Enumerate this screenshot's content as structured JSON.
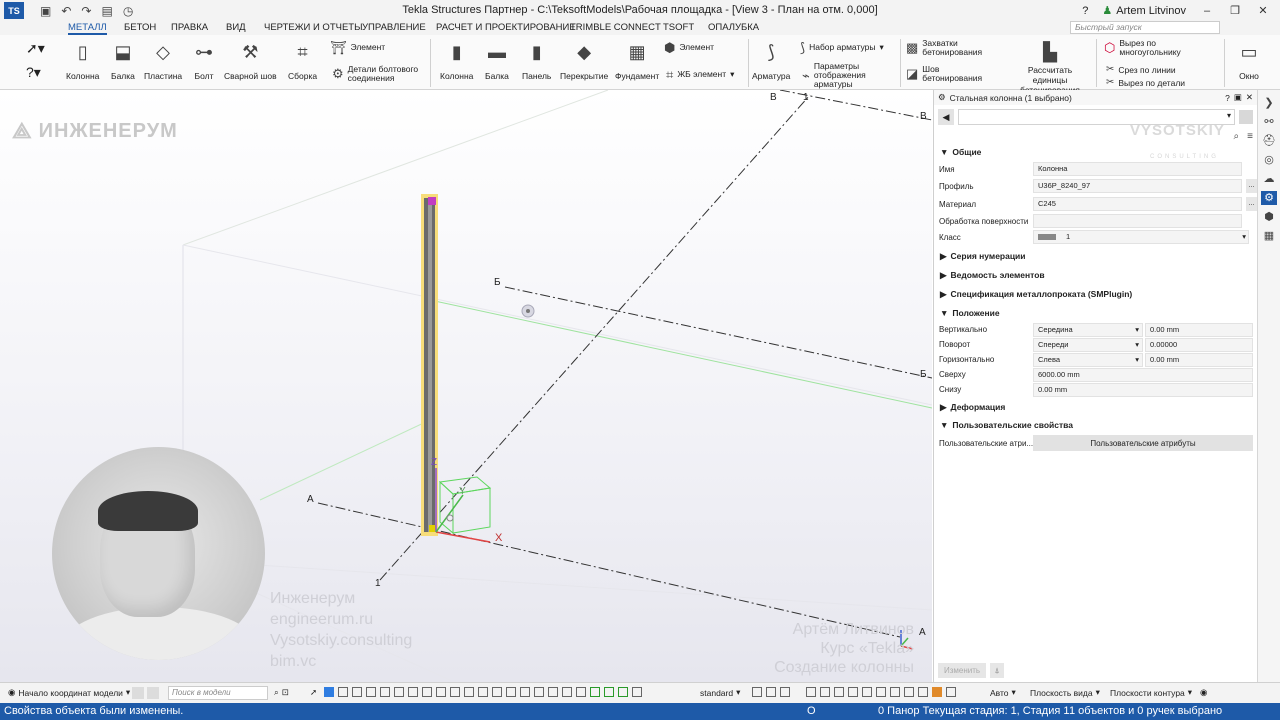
{
  "titlebar": {
    "title": "Tekla Structures Партнер - C:\\TeksoftModels\\Рабочая площадка  - [View 3 - План на отм. 0,000]",
    "user": "Artem Litvinov",
    "quick_launch_placeholder": "Быстрый запуск"
  },
  "ribbon_tabs": [
    "МЕТАЛЛ",
    "БЕТОН",
    "ПРАВКА",
    "ВИД",
    "ЧЕРТЕЖИ И ОТЧЕТЫ",
    "УПРАВЛЕНИЕ",
    "РАСЧЕТ И ПРОЕКТИРОВАНИЕ",
    "TRIMBLE CONNECT",
    "TSOFT",
    "ОПАЛУБКА"
  ],
  "ribbon": {
    "steel_column": "Колонна",
    "steel_beam": "Балка",
    "plate": "Пластина",
    "bolt": "Болт",
    "weld": "Сварной шов",
    "assembly": "Сборка",
    "element": "Элемент",
    "bolt_parts": "Детали болтового соединения",
    "concrete_column": "Колонна",
    "concrete_beam": "Балка",
    "panel": "Панель",
    "slab": "Перекрытие",
    "foundation": "Фундамент",
    "concrete_element": "Элемент",
    "rc_element": "ЖБ элемент",
    "rebar": "Арматура",
    "rebar_set": "Набор арматуры",
    "rebar_display": "Параметры отображения арматуры",
    "pour_breaks": "Захватки бетонирования",
    "pour_joint": "Шов бетонирования",
    "calc_pour": "Рассчитать единицы бетонирования",
    "polygon_cut": "Вырез по многоугольнику",
    "line_cut": "Срез по линии",
    "part_cut": "Вырез по детали",
    "window": "Окно"
  },
  "viewport": {
    "watermark_logo": "ИНЖЕНЕРУМ",
    "watermark_links": [
      "Инженерум",
      "engineerum.ru",
      "Vysotskiy.consulting",
      "bim.vc"
    ],
    "course_lines": [
      "Артём Литвинов",
      "Курс «Tekla»",
      "Создание колонны"
    ],
    "grid_labels": {
      "a": "А",
      "b": "Б",
      "v": "В",
      "one": "1"
    },
    "axis_labels": {
      "x": "X",
      "y": "Y",
      "z": "Z"
    }
  },
  "props": {
    "header": "Стальная колонна (1 выбрано)",
    "brand": "VYSOTSKIY",
    "brand_sub": "CONSULTING",
    "section_general": "Общие",
    "name_label": "Имя",
    "name_value": "Колонна",
    "profile_label": "Профиль",
    "profile_value": "U36P_8240_97",
    "material_label": "Материал",
    "material_value": "C245",
    "finish_label": "Обработка поверхности",
    "finish_value": "",
    "class_label": "Класс",
    "class_value": "1",
    "section_numbering": "Серия нумерации",
    "section_schedule": "Ведомость элементов",
    "section_spec": "Спецификация металлопроката (SMPlugin)",
    "section_position": "Положение",
    "vertical_label": "Вертикально",
    "vertical_value": "Середина",
    "vertical_offset": "0.00 mm",
    "rotation_label": "Поворот",
    "rotation_value": "Спереди",
    "rotation_offset": "0.00000",
    "horizontal_label": "Горизонтально",
    "horizontal_value": "Слева",
    "horizontal_offset": "0.00 mm",
    "top_label": "Сверху",
    "top_value": "6000.00 mm",
    "bottom_label": "Снизу",
    "bottom_value": "0.00 mm",
    "section_deform": "Деформация",
    "section_user": "Пользовательские свойства",
    "user_attr_label": "Пользовательские атри...",
    "user_attr_button": "Пользовательские атрибуты",
    "modify_button": "Изменить"
  },
  "bottombar": {
    "origin": "Начало координат модели",
    "search_placeholder": "Поиск в модели",
    "standard": "standard",
    "auto": "Авто",
    "view_plane": "Плоскость вида",
    "contour_plane": "Плоскости контура"
  },
  "statusbar": {
    "message": "Свойства объекта были изменены.",
    "o": "O",
    "phase": "0  Панор Текущая стадия: 1, Стадия 1",
    "count": "1 объектов и 0 ручек выбрано"
  },
  "colors": {
    "accent": "#1e5aa8",
    "column_highlight": "#f2c230",
    "grid_line": "#333333",
    "green_line": "#7fd67f"
  }
}
